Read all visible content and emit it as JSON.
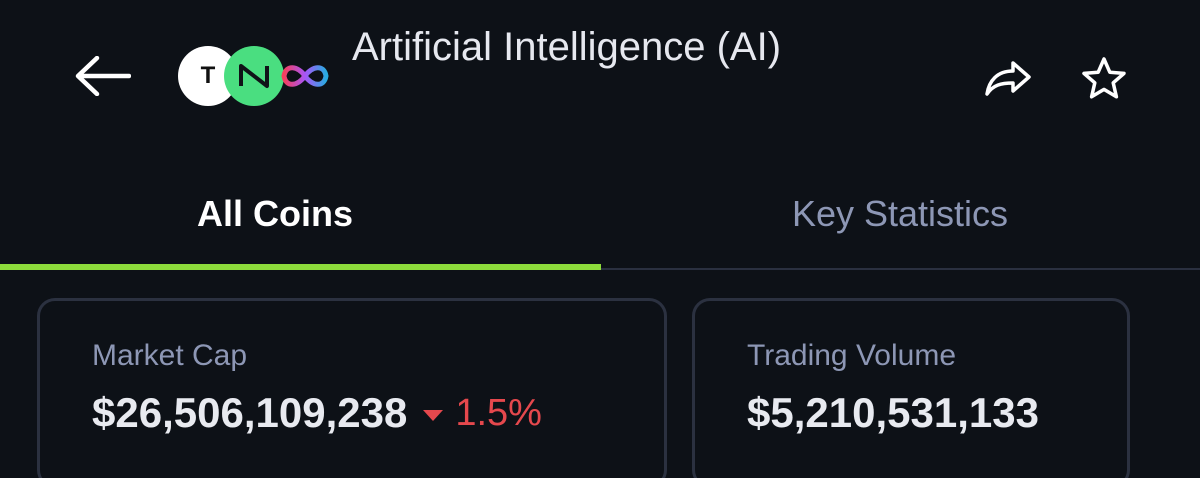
{
  "header": {
    "title": "Artificial Intelligence (AI)",
    "logos": {
      "first_letter": "T",
      "icons": [
        "t-coin-logo",
        "near-logo",
        "infinity-logo"
      ]
    },
    "back_icon": "arrow-left-icon",
    "share_icon": "share-icon",
    "favorite_icon": "star-icon"
  },
  "tabs": [
    {
      "label": "All Coins",
      "active": true
    },
    {
      "label": "Key Statistics",
      "active": false
    }
  ],
  "stats": {
    "market_cap": {
      "label": "Market Cap",
      "value": "$26,506,109,238",
      "change": "1.5%",
      "direction": "down"
    },
    "trading_volume": {
      "label": "Trading Volume",
      "value": "$5,210,531,133"
    }
  },
  "colors": {
    "background": "#0d1117",
    "accent": "#8ddc3c",
    "negative": "#e5484d",
    "muted": "#8d97b5"
  }
}
